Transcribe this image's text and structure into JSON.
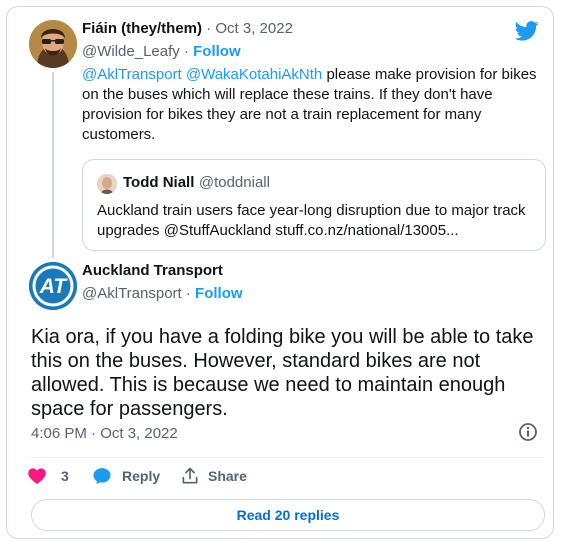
{
  "reply": {
    "name": "Fiáin (they/them)",
    "separator": " · ",
    "date": "Oct 3, 2022",
    "handle": "@Wilde_Leafy",
    "dot": " · ",
    "follow": "Follow",
    "mention1": "@AklTransport",
    "mention2": "@WakaKotahiAkNth",
    "line1_tail": " please make provision for bikes",
    "line2": "on the buses which will replace these trains. If they don't have",
    "line3": "provision for bikes they are not a train replacement for many",
    "line4": "customers."
  },
  "quote": {
    "name": "Todd Niall",
    "handle": "@toddniall",
    "line1": "Auckland train users face year-long disruption due to major track",
    "line2": "upgrades @StuffAuckland  stuff.co.nz/national/13005..."
  },
  "main": {
    "name": "Auckland Transport",
    "handle": "@AklTransport",
    "dot": " · ",
    "follow": "Follow",
    "avatar_text": "AT",
    "text_line1": "Kia ora, if you have a folding bike you will be able to take",
    "text_line2": "this on the buses. However, standard bikes are not",
    "text_line3": "allowed. This is because we need to maintain enough",
    "text_line4": "space for passengers.",
    "timestamp": "4:06 PM · Oct 3, 2022"
  },
  "actions": {
    "like_count": "3",
    "reply_label": "Reply",
    "share_label": "Share",
    "read_replies": "Read 20 replies"
  },
  "colors": {
    "link": "#1d9bf0",
    "like": "#f91880",
    "at_brand": "#1a7ab9"
  },
  "icons": [
    "twitter-bird-icon",
    "info-icon",
    "heart-icon",
    "reply-bubble-icon",
    "share-icon"
  ]
}
